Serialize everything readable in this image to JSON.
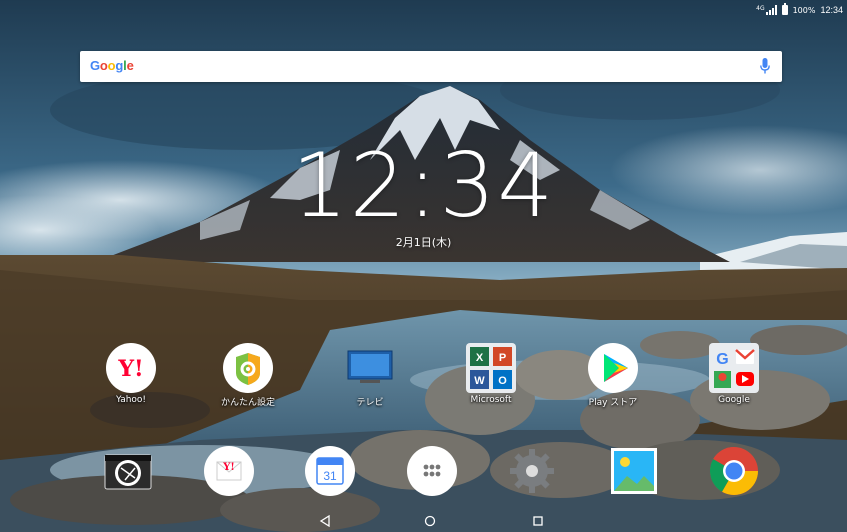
{
  "status_bar": {
    "network_label": "4G",
    "battery_percent": "100%",
    "time": "12:34"
  },
  "search": {
    "logo_text": "Google"
  },
  "clock": {
    "time": "12:34",
    "date": "2月1日(木)"
  },
  "apps_row1": [
    {
      "label": "Yahoo!",
      "icon": "yahoo-icon"
    },
    {
      "label": "かんたん設定",
      "icon": "easy-settings-icon"
    },
    {
      "label": "テレビ",
      "icon": "tv-icon"
    },
    {
      "label": "Microsoft",
      "icon": "microsoft-folder-icon"
    },
    {
      "label": "Play ストア",
      "icon": "play-store-icon"
    },
    {
      "label": "Google",
      "icon": "google-folder-icon"
    }
  ],
  "dock": [
    {
      "icon": "camera-icon"
    },
    {
      "icon": "yahoo-mail-icon"
    },
    {
      "icon": "calendar-icon",
      "text": "31"
    },
    {
      "icon": "app-drawer-icon"
    },
    {
      "icon": "settings-icon"
    },
    {
      "icon": "gallery-icon"
    },
    {
      "icon": "chrome-icon"
    }
  ],
  "colors": {
    "google_blue": "#4285F4",
    "google_red": "#EA4335",
    "google_yellow": "#FBBC05",
    "google_green": "#34A853"
  }
}
